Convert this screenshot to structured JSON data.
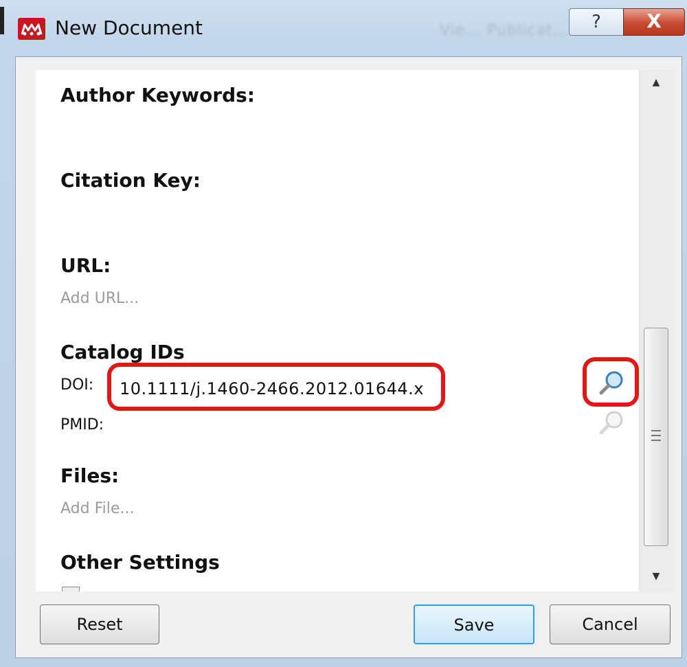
{
  "window": {
    "title": "New Document",
    "background_hint": "Vie... Publicat...",
    "help_glyph": "?",
    "close_glyph": "X"
  },
  "sections": {
    "author_keywords": "Author Keywords:",
    "citation_key": "Citation Key:",
    "url": "URL:",
    "url_placeholder": "Add URL...",
    "catalog_ids": "Catalog IDs",
    "doi_label": "DOI:",
    "doi_value": "10.1111/j.1460-2466.2012.01644.x",
    "pmid_label": "PMID:",
    "files": "Files:",
    "files_placeholder": "Add File...",
    "other_settings": "Other Settings"
  },
  "icons": {
    "app": "mendeley-logo-icon",
    "doi_lookup": "magnifier-icon",
    "pmid_lookup": "magnifier-icon",
    "scroll_up": "arrow-up-icon",
    "scroll_down": "arrow-down-icon"
  },
  "buttons": {
    "reset": "Reset",
    "save": "Save",
    "cancel": "Cancel"
  },
  "colors": {
    "highlight": "#e01818",
    "brand": "#c41a1f",
    "default_button_border": "#3c9ad6"
  }
}
